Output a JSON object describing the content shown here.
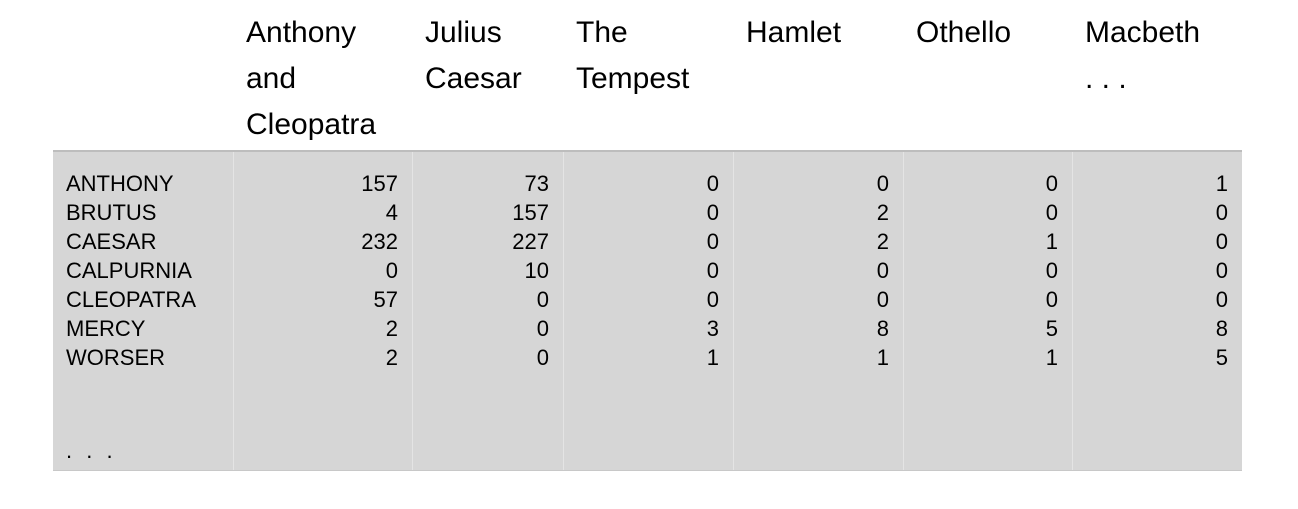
{
  "columns": [
    "Anthony\nand\nCleopatra",
    "Julius\nCaesar",
    "The\nTempest",
    "Hamlet",
    "Othello",
    "Macbeth\n. . ."
  ],
  "rows": [
    {
      "term": "ANTHONY",
      "values": [
        "157",
        "73",
        "0",
        "0",
        "0",
        "1"
      ]
    },
    {
      "term": "BRUTUS",
      "values": [
        "4",
        "157",
        "0",
        "2",
        "0",
        "0"
      ]
    },
    {
      "term": "CAESAR",
      "values": [
        "232",
        "227",
        "0",
        "2",
        "1",
        "0"
      ]
    },
    {
      "term": "CALPURNIA",
      "values": [
        "0",
        "10",
        "0",
        "0",
        "0",
        "0"
      ]
    },
    {
      "term": "CLEOPATRA",
      "values": [
        "57",
        "0",
        "0",
        "0",
        "0",
        "0"
      ]
    },
    {
      "term": "MERCY",
      "values": [
        "2",
        "0",
        "3",
        "8",
        "5",
        "8"
      ]
    },
    {
      "term": "WORSER",
      "values": [
        "2",
        "0",
        "1",
        "1",
        "1",
        "5"
      ]
    }
  ],
  "more_rows": ". . .",
  "colors": {
    "body_background": "#d6d6d6",
    "separator": "#e4e4e4"
  }
}
